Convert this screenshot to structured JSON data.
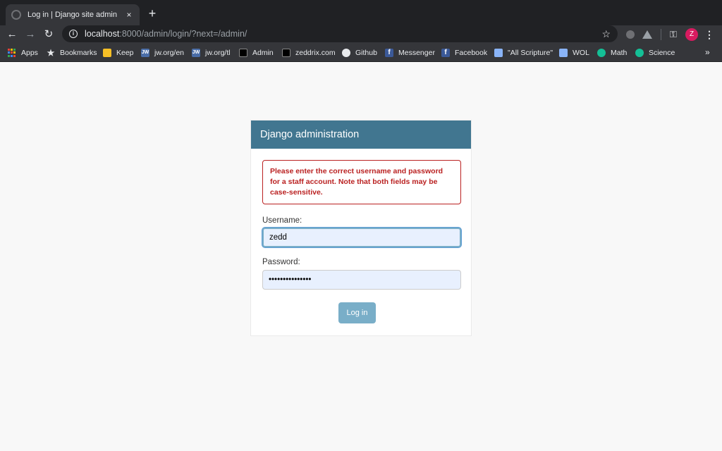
{
  "browser": {
    "tab_title": "Log in | Django site admin",
    "tab_close": "×",
    "new_tab": "+",
    "url_host": "localhost",
    "url_rest": ":8000/admin/login/?next=/admin/",
    "avatar_letter": "Z",
    "icons": {
      "back": "←",
      "forward": "→",
      "reload": "↻",
      "info": "i",
      "star": "☆",
      "key": "⚿",
      "menu": "⋮"
    }
  },
  "bookmarks": {
    "items": [
      {
        "label": "Apps",
        "icon": "apps-grid-icon"
      },
      {
        "label": "Bookmarks",
        "icon": "star-icon"
      },
      {
        "label": "Keep",
        "icon": "keep-icon",
        "color": "#f6bf26"
      },
      {
        "label": "jw.org/en",
        "icon": "jw-icon",
        "color": "#4a6da7",
        "glyph": "JW"
      },
      {
        "label": "jw.org/tl",
        "icon": "jw-icon",
        "color": "#4a6da7",
        "glyph": "JW"
      },
      {
        "label": "Admin",
        "icon": "admin-icon",
        "color": "#000000"
      },
      {
        "label": "zeddrix.com",
        "icon": "zeddrix-icon",
        "color": "#000000"
      },
      {
        "label": "Github",
        "icon": "github-icon",
        "color": "#202124"
      },
      {
        "label": "Messenger",
        "icon": "facebook-icon",
        "color": "#3b5998",
        "glyph": "f"
      },
      {
        "label": "Facebook",
        "icon": "facebook-icon",
        "color": "#3b5998",
        "glyph": "f"
      },
      {
        "label": "\"All Scripture\"",
        "icon": "book-icon",
        "color": "#8ab4f8"
      },
      {
        "label": "WOL",
        "icon": "book-icon",
        "color": "#8ab4f8"
      },
      {
        "label": "Math",
        "icon": "khan-icon",
        "color": "#14bf96"
      },
      {
        "label": "Science",
        "icon": "khan-icon",
        "color": "#14bf96"
      }
    ],
    "more": "»"
  },
  "login": {
    "header": "Django administration",
    "error": "Please enter the correct username and password for a staff account. Note that both fields may be case-sensitive.",
    "username_label": "Username:",
    "username_value": "zedd",
    "password_label": "Password:",
    "password_value": "•••••••••••••••",
    "submit_label": "Log in"
  },
  "colors": {
    "header_bg": "#417690",
    "error": "#ba2121",
    "button": "#79aec8",
    "input_bg": "#e8f0fe"
  }
}
